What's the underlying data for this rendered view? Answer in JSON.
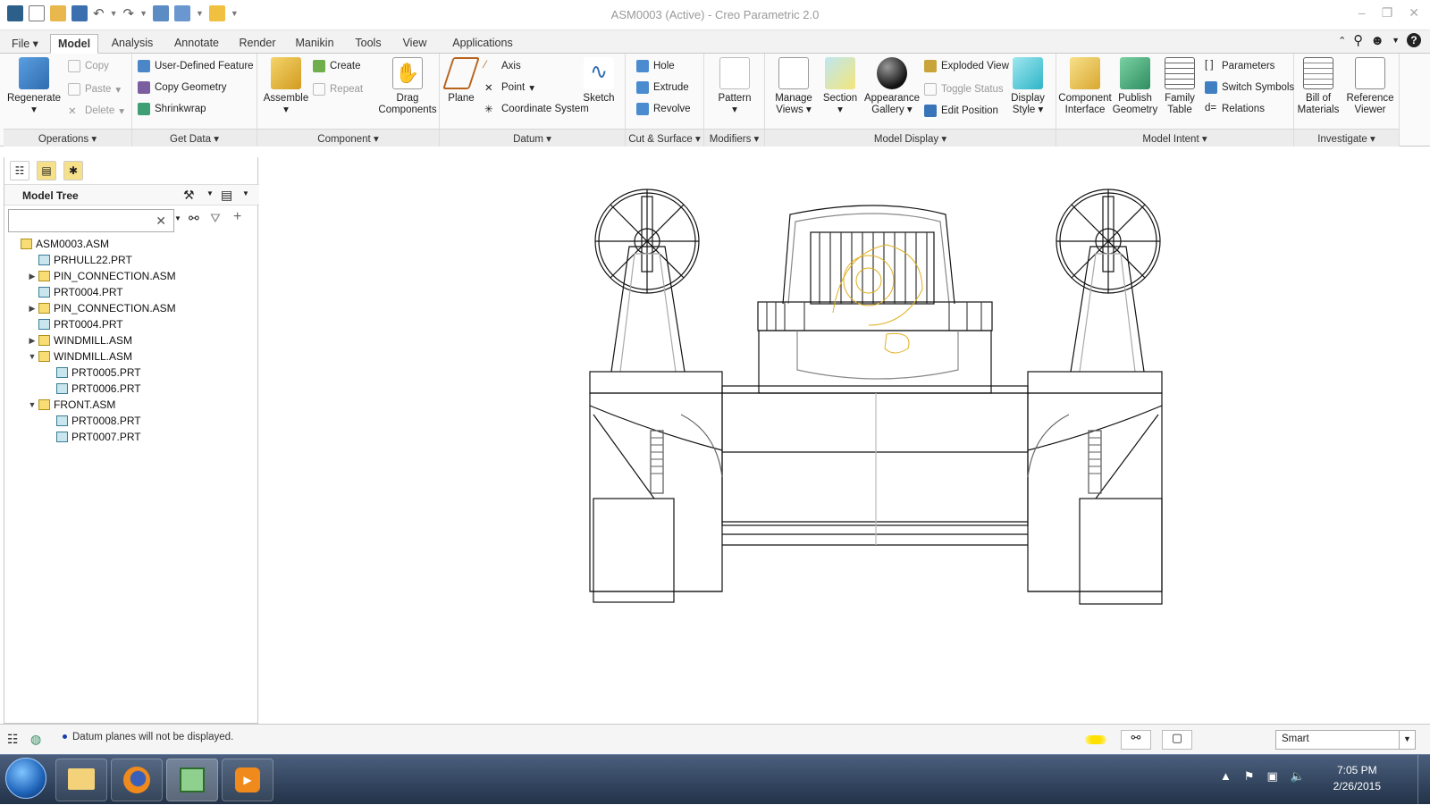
{
  "window": {
    "title": "ASM0003 (Active) - Creo Parametric 2.0",
    "controls": [
      "–",
      "❐",
      "✕"
    ]
  },
  "tabs": [
    "File",
    "Model",
    "Analysis",
    "Annotate",
    "Render",
    "Manikin",
    "Tools",
    "View",
    "Applications"
  ],
  "active_tab": "Model",
  "ribbon": {
    "operations": {
      "label": "Operations",
      "regenerate": "Regenerate",
      "copy": "Copy",
      "paste": "Paste",
      "delete": "Delete"
    },
    "get_data": {
      "label": "Get Data",
      "udf": "User-Defined Feature",
      "copy_geometry": "Copy Geometry",
      "shrinkwrap": "Shrinkwrap"
    },
    "component": {
      "label": "Component",
      "assemble": "Assemble",
      "create": "Create",
      "repeat": "Repeat",
      "drag_line1": "Drag",
      "drag_line2": "Components"
    },
    "datum": {
      "label": "Datum",
      "plane": "Plane",
      "axis": "Axis",
      "point": "Point",
      "coord": "Coordinate System",
      "sketch": "Sketch"
    },
    "cut_surface": {
      "label": "Cut & Surface",
      "hole": "Hole",
      "extrude": "Extrude",
      "revolve": "Revolve"
    },
    "modifiers": {
      "label": "Modifiers",
      "pattern": "Pattern"
    },
    "model_display": {
      "label": "Model Display",
      "manage_views_1": "Manage",
      "manage_views_2": "Views",
      "section": "Section",
      "appearance_1": "Appearance",
      "appearance_2": "Gallery",
      "exploded": "Exploded View",
      "toggle_status": "Toggle Status",
      "edit_position": "Edit Position",
      "display_style_1": "Display",
      "display_style_2": "Style"
    },
    "model_intent": {
      "label": "Model Intent",
      "component_interface_1": "Component",
      "component_interface_2": "Interface",
      "publish_1": "Publish",
      "publish_2": "Geometry",
      "family_1": "Family",
      "family_2": "Table",
      "parameters": "Parameters",
      "switch_symbols": "Switch Symbols",
      "relations": "Relations"
    },
    "investigate": {
      "label": "Investigate",
      "bom_1": "Bill of",
      "bom_2": "Materials",
      "refviewer_1": "Reference",
      "refviewer_2": "Viewer"
    }
  },
  "model_tree": {
    "title": "Model Tree",
    "search_value": "",
    "items": [
      {
        "name": "ASM0003.ASM",
        "kind": "asm",
        "depth": 0,
        "toggle": ""
      },
      {
        "name": "PRHULL22.PRT",
        "kind": "prt",
        "depth": 1,
        "toggle": ""
      },
      {
        "name": "PIN_CONNECTION.ASM",
        "kind": "asm",
        "depth": 1,
        "toggle": "▶"
      },
      {
        "name": "PRT0004.PRT",
        "kind": "prt",
        "depth": 1,
        "toggle": ""
      },
      {
        "name": "PIN_CONNECTION.ASM",
        "kind": "asm",
        "depth": 1,
        "toggle": "▶"
      },
      {
        "name": "PRT0004.PRT",
        "kind": "prt",
        "depth": 1,
        "toggle": ""
      },
      {
        "name": "WINDMILL.ASM",
        "kind": "asm",
        "depth": 1,
        "toggle": "▶"
      },
      {
        "name": "WINDMILL.ASM",
        "kind": "asm",
        "depth": 1,
        "toggle": "▼"
      },
      {
        "name": "PRT0005.PRT",
        "kind": "prt",
        "depth": 2,
        "toggle": ""
      },
      {
        "name": "PRT0006.PRT",
        "kind": "prt",
        "depth": 2,
        "toggle": ""
      },
      {
        "name": "FRONT.ASM",
        "kind": "asm",
        "depth": 1,
        "toggle": "▼"
      },
      {
        "name": "PRT0008.PRT",
        "kind": "prt",
        "depth": 2,
        "toggle": ""
      },
      {
        "name": "PRT0007.PRT",
        "kind": "prt",
        "depth": 2,
        "toggle": ""
      }
    ]
  },
  "status": {
    "message": "Datum planes will not be displayed.",
    "filter_value": "Smart"
  },
  "taskbar": {
    "time": "7:05 PM",
    "date": "2/26/2015"
  }
}
